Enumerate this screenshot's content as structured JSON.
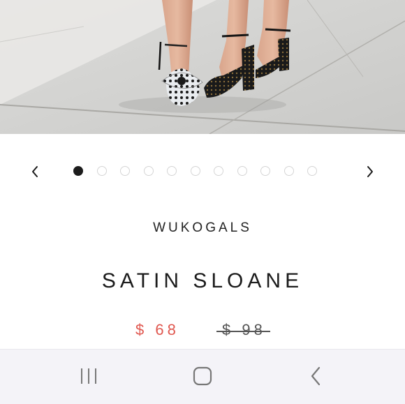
{
  "product": {
    "brand": "WUKOGALS",
    "name": "SATIN SLOANE",
    "price_current": "$ 68",
    "price_original": "$ 98"
  },
  "carousel": {
    "total_slides": 11,
    "active_index": 0,
    "prev_icon": "chevron-left-icon",
    "next_icon": "chevron-right-icon"
  },
  "colors": {
    "price_current": "#e0574f",
    "price_original": "#555555",
    "active_dot": "#1c1c1c",
    "navbar_bg": "#f4f3f8"
  },
  "navbar": {
    "recents_icon": "recent-apps-icon",
    "home_icon": "home-icon",
    "back_icon": "back-icon"
  }
}
